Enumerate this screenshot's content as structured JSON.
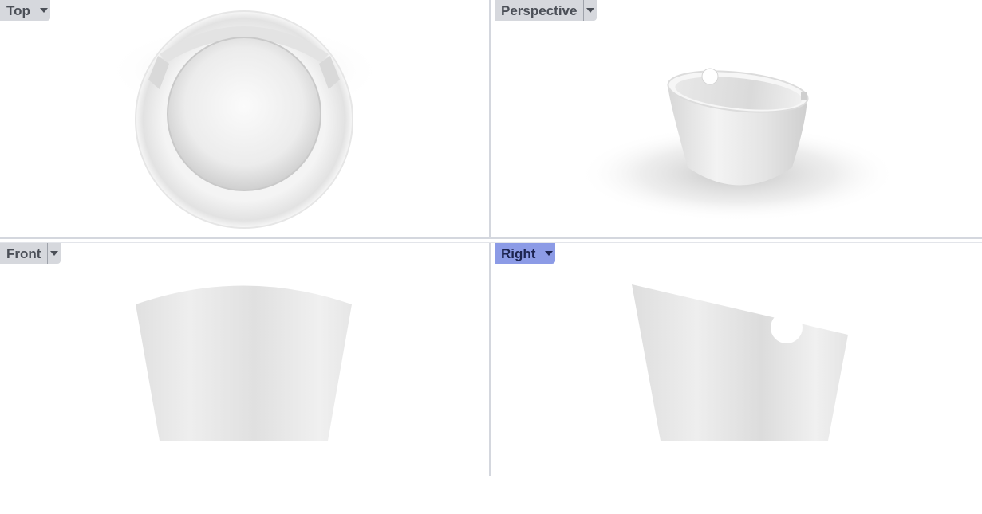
{
  "viewports": {
    "top": {
      "label": "Top",
      "active": false
    },
    "perspective": {
      "label": "Perspective",
      "active": false
    },
    "front": {
      "label": "Front",
      "active": false
    },
    "right": {
      "label": "Right",
      "active": true
    }
  },
  "colors": {
    "active_tab": "#8c9be6",
    "inactive_tab": "#d6d8dd",
    "model_surface": "#ececec",
    "divider": "#d4d7de"
  },
  "icons": {
    "tab_menu": "chevron-down-icon"
  }
}
